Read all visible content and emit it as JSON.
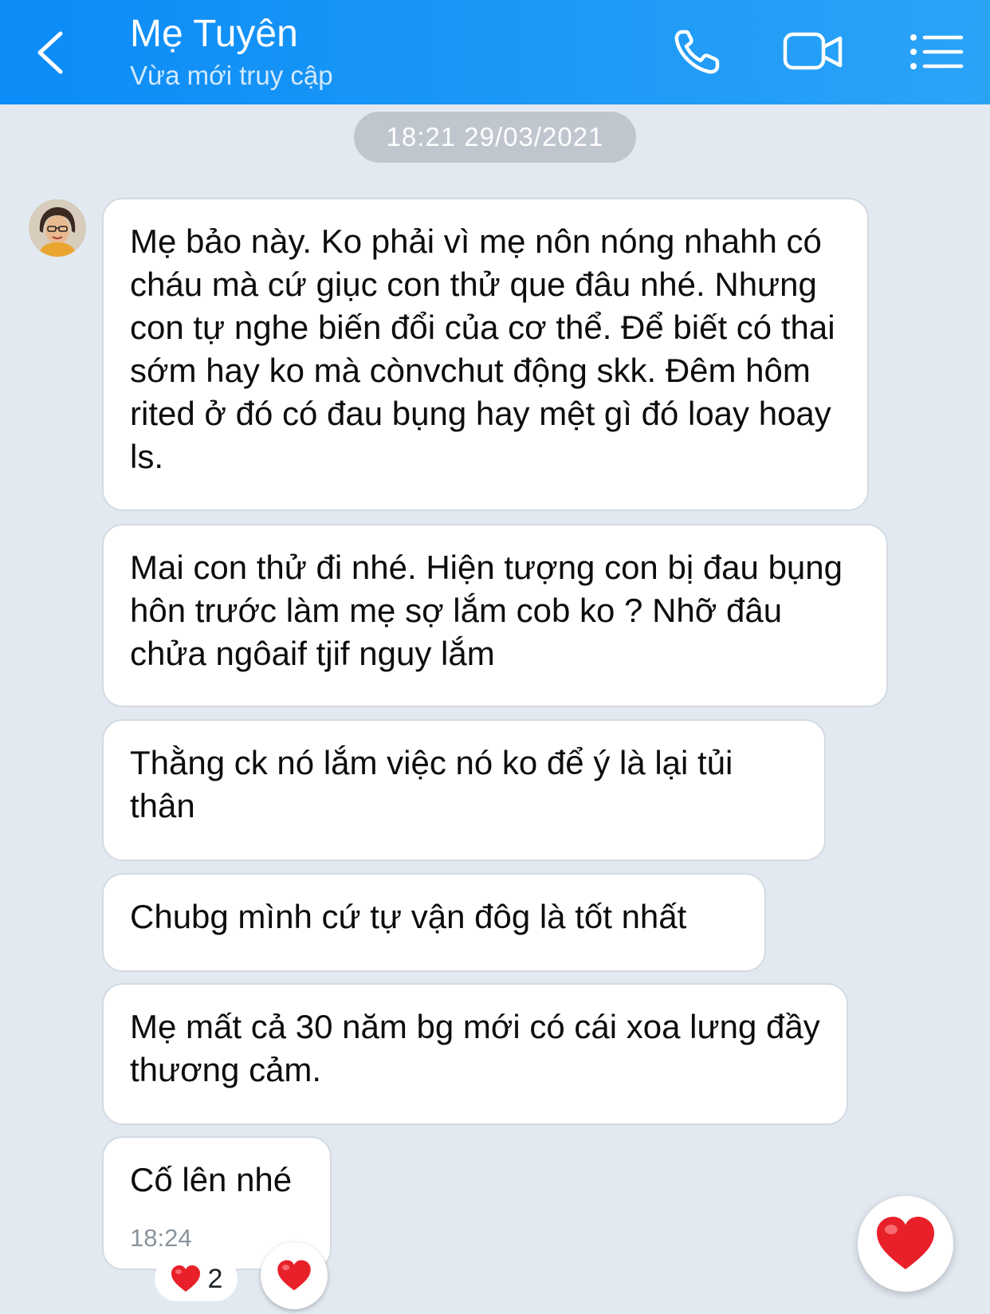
{
  "header": {
    "contact_name": "Mẹ Tuyên",
    "status": "Vừa mới truy cập",
    "icons": [
      "back-icon",
      "phone-icon",
      "video-call-icon",
      "menu-list-icon"
    ]
  },
  "chat": {
    "date_separator": "18:21 29/03/2021",
    "messages": [
      {
        "text": "Mẹ bảo này. Ko phải vì mẹ nôn nóng nhahh có cháu mà cứ giục con thử que đâu nhé. Nhưng con tự nghe biến đổi của cơ thể. Để biết có thai sớm hay ko mà cònvchut động skk. Đêm hôm rited ở đó có đau bụng hay mệt gì đó loay hoay ls."
      },
      {
        "text": "Mai con thử đi nhé. Hiện tượng con bị đau bụng hôn trước làm mẹ sợ lắm cob ko ?  Nhỡ đâu chửa ngôaif tjif nguy lắm"
      },
      {
        "text": "Thằng ck nó lắm việc nó ko để ý là lại tủi thân"
      },
      {
        "text": "Chubg mình cứ tự vận đôg là tốt nhất"
      },
      {
        "text": "Mẹ mất cả 30 năm bg mới có cái xoa lưng đầy thương cảm."
      },
      {
        "text": "Cố lên nhé",
        "time": "18:24"
      }
    ],
    "reaction": {
      "emoji": "heart",
      "count": "2"
    }
  },
  "colors": {
    "header_start": "#0b8cf7",
    "header_end": "#2aa3f7",
    "chat_background": "#e2e9f1",
    "bubble": "#ffffff",
    "date_chip": "#bfc6ce",
    "heart": "#e8202a"
  }
}
